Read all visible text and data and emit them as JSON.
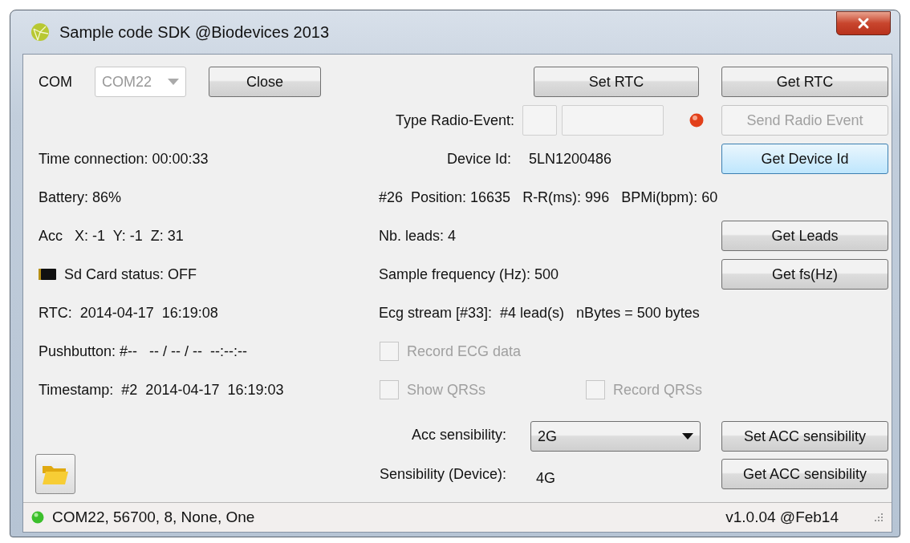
{
  "window": {
    "title": "Sample code SDK @Biodevices 2013"
  },
  "connection": {
    "label": "COM",
    "port": "COM22",
    "port_disabled": true,
    "button": {
      "label": "Close",
      "disabled": false,
      "focused": false
    }
  },
  "rtc_buttons": [
    {
      "label": "Set RTC",
      "disabled": false,
      "focused": false
    },
    {
      "label": "Get RTC",
      "disabled": false,
      "focused": false
    }
  ],
  "radio_event": {
    "label": "Type Radio-Event:",
    "button": {
      "label": "Send Radio Event",
      "disabled": true,
      "focused": false
    }
  },
  "device": {
    "label": "Device Id:",
    "value": "5LN1200486",
    "button": {
      "label": "Get Device Id",
      "disabled": false,
      "focused": true
    }
  },
  "left_info": [
    {
      "kind": "text",
      "text": "Time connection: 00:00:33"
    },
    {
      "kind": "text",
      "text": "Battery: 86%"
    },
    {
      "kind": "text",
      "text": "Acc   X: -1  Y: -1  Z: 31"
    },
    {
      "kind": "sdcard",
      "text": "Sd Card status: OFF"
    },
    {
      "kind": "text",
      "text": "RTC:  2014-04-17  16:19:08"
    },
    {
      "kind": "text",
      "text": "Pushbutton: #--   -- / -- / --  --:--:--"
    },
    {
      "kind": "text",
      "text": "Timestamp:  #2  2014-04-17  16:19:03"
    }
  ],
  "beat_info": "#26  Position: 16635   R-R(ms): 996   BPMi(bpm): 60",
  "leads": {
    "text": "Nb. leads: 4",
    "button": {
      "label": "Get Leads",
      "disabled": false,
      "focused": false
    }
  },
  "frequency": {
    "text": "Sample frequency (Hz): 500",
    "button": {
      "label": "Get fs(Hz)",
      "disabled": false,
      "focused": false
    }
  },
  "ecg_stream": "Ecg stream [#33]:  #4 lead(s)   nBytes = 500 bytes",
  "checkboxes": [
    {
      "label": "Record ECG data",
      "checked": false,
      "disabled": true
    },
    {
      "label": "Show QRSs",
      "checked": false,
      "disabled": true
    },
    {
      "label": "Record QRSs",
      "checked": false,
      "disabled": true
    }
  ],
  "acc_sensibility": {
    "label": "Acc sensibility:",
    "value": "2G",
    "button": {
      "label": "Set ACC sensibility",
      "disabled": false,
      "focused": false
    }
  },
  "device_sensibility": {
    "label": "Sensibility (Device):",
    "value": "4G",
    "button": {
      "label": "Get ACC sensibility",
      "disabled": false,
      "focused": false
    }
  },
  "status_bar": {
    "connection": "COM22, 56700, 8, None, One",
    "version": "v1.0.04 @Feb14"
  }
}
